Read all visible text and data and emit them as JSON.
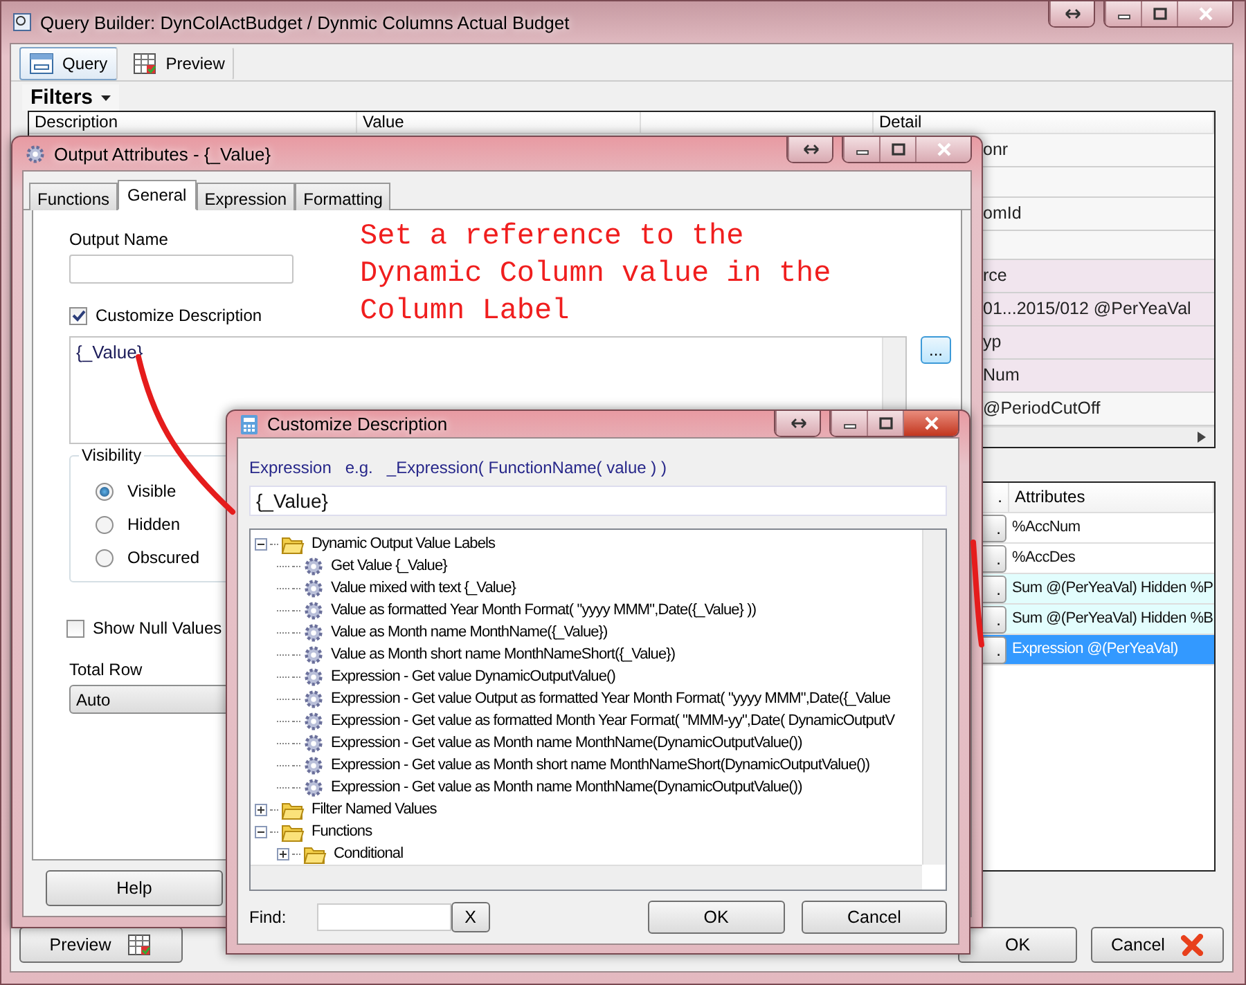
{
  "main_window": {
    "title": "Query Builder:  DynColActBudget / Dynmic Columns Actual Budget",
    "tabs": [
      {
        "label": "Query",
        "selected": true
      },
      {
        "label": "Preview",
        "selected": false
      }
    ],
    "filters_button": "Filters",
    "filters_grid": {
      "columns": [
        "Description",
        "Value",
        "Detail"
      ],
      "rows": [
        {
          "detail": "onr",
          "shaded": false
        },
        {
          "shaded": false
        },
        {
          "detail": "omId",
          "shaded": false
        },
        {
          "shaded": false
        },
        {
          "detail": "rce",
          "shaded": true
        },
        {
          "detail": "01...2015/012 @PerYeaVal",
          "shaded": true
        },
        {
          "detail": "yp",
          "shaded": true
        },
        {
          "detail": "Num",
          "shaded": true
        },
        {
          "detail": "@PeriodCutOff",
          "shaded": false
        }
      ]
    },
    "attributes_grid": {
      "columns": [
        ".",
        "Attributes"
      ],
      "rows": [
        {
          "button": ".",
          "text": "%AccNum",
          "highlighted": false,
          "selected": false
        },
        {
          "button": ".",
          "text": "%AccDes",
          "highlighted": false,
          "selected": false
        },
        {
          "button": ".",
          "text": "Sum @(PerYeaVal) Hidden %P",
          "highlighted": true,
          "selected": false
        },
        {
          "button": ".",
          "text": "Sum @(PerYeaVal) Hidden %B",
          "highlighted": true,
          "selected": false
        },
        {
          "button": ".",
          "text": "Expression @(PerYeaVal)",
          "highlighted": false,
          "selected": true
        }
      ]
    },
    "buttons": [
      {
        "label": "Preview",
        "kind": "preview"
      },
      {
        "label": "OK",
        "kind": "ok"
      },
      {
        "label": "Cancel",
        "kind": "cancel"
      }
    ]
  },
  "output_dialog": {
    "title": "Output Attributes - {_Value}",
    "tabs": [
      {
        "label": "Functions",
        "selected": false
      },
      {
        "label": "General",
        "selected": true
      },
      {
        "label": "Expression",
        "selected": false
      },
      {
        "label": "Formatting",
        "selected": false
      }
    ],
    "output_name_label": "Output Name",
    "customize_description": {
      "label": "Customize Description",
      "checked": true
    },
    "description_text": "{_Value}",
    "browse_button": "...",
    "visibility": {
      "label": "Visibility",
      "options": [
        {
          "label": "Visible",
          "selected": true
        },
        {
          "label": "Hidden",
          "selected": false
        },
        {
          "label": "Obscured",
          "selected": false
        }
      ]
    },
    "show_null_values": {
      "label": "Show Null Values",
      "checked": false
    },
    "total_row": {
      "label": "Total Row",
      "value": "Auto"
    },
    "help_button": "Help"
  },
  "customize_dialog": {
    "title": "Customize Description",
    "expression_label": "Expression",
    "example_label": "e.g.",
    "example": "_Expression( FunctionName( value ) )",
    "expression_value": "{_Value}",
    "tree": [
      {
        "label": "Dynamic Output Value Labels",
        "kind": "folder",
        "expanded": true,
        "children": [
          {
            "label": "Get Value {_Value}",
            "kind": "function"
          },
          {
            "label": "Value mixed with text {_Value}",
            "kind": "function"
          },
          {
            "label": "Value as formatted Year Month Format( \"yyyy MMM\",Date({_Value} ))",
            "kind": "function"
          },
          {
            "label": "Value as Month name MonthName({_Value})",
            "kind": "function"
          },
          {
            "label": "Value as Month short name MonthNameShort({_Value})",
            "kind": "function"
          },
          {
            "label": "Expression - Get value DynamicOutputValue()",
            "kind": "function"
          },
          {
            "label": "Expression - Get value Output as formatted Year Month Format( \"yyyy MMM\",Date({_Value",
            "kind": "function"
          },
          {
            "label": "Expression - Get value as formatted Month Year Format( \"MMM-yy\",Date( DynamicOutputV",
            "kind": "function"
          },
          {
            "label": "Expression - Get value as Month name MonthName(DynamicOutputValue())",
            "kind": "function"
          },
          {
            "label": "Expression - Get value as Month short name MonthNameShort(DynamicOutputValue())",
            "kind": "function"
          },
          {
            "label": "Expression - Get value as Month name MonthName(DynamicOutputValue())",
            "kind": "function"
          }
        ]
      },
      {
        "label": "Filter Named Values",
        "kind": "folder",
        "expanded": false
      },
      {
        "label": "Functions",
        "kind": "folder",
        "expanded": true,
        "children": [
          {
            "label": "Conditional",
            "kind": "folder",
            "expanded": false
          }
        ]
      }
    ],
    "find_label": "Find:",
    "clear_button": "X",
    "ok_button": "OK",
    "cancel_button": "Cancel"
  },
  "annotation": "Set a reference to the Dynamic Column value in the Column Label"
}
